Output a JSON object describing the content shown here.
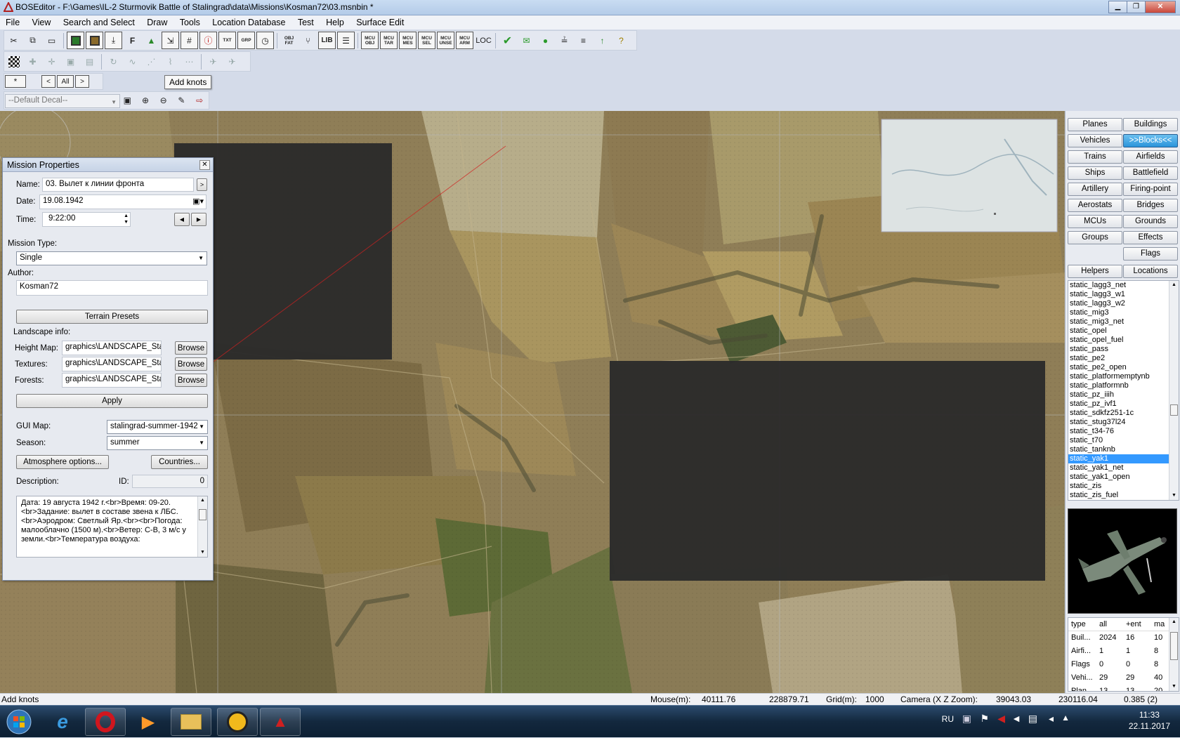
{
  "window": {
    "title": "BOSEditor - F:\\Games\\IL-2 Sturmovik Battle of Stalingrad\\data\\Missions\\Kosman72\\03.msnbin *",
    "minimize": "▁",
    "maximize": "❐",
    "close": "✕"
  },
  "menu": [
    "File",
    "View",
    "Search and Select",
    "Draw",
    "Tools",
    "Location Database",
    "Test",
    "Help",
    "Surface Edit"
  ],
  "toolbar": {
    "row1_mcu": [
      "MCU OBJ",
      "MCU TAR",
      "MCU MES",
      "MCU SEL",
      "MCU UNSE",
      "MCU ARM"
    ],
    "loc_label": "LOC",
    "lib_label": "LIB",
    "txt_label": "TXT",
    "grp_label": "GRP",
    "obj_label": "OBJ FAT",
    "nav": {
      "star": "*",
      "prev": "<",
      "all": "All",
      "next": ">"
    },
    "tooltip": "Add knots",
    "decal_select": "--Default Decal--"
  },
  "mission_properties": {
    "title": "Mission Properties",
    "name_label": "Name:",
    "name_value": "03. Вылет к линии фронта",
    "date_label": "Date:",
    "date_value": "19.08.1942",
    "time_label": "Time:",
    "time_value": "9:22:00",
    "mission_type_label": "Mission Type:",
    "mission_type_value": "Single",
    "author_label": "Author:",
    "author_value": "Kosman72",
    "terrain_presets": "Terrain Presets",
    "landscape_label": "Landscape info:",
    "height_map_label": "Height Map:",
    "height_map_value": "graphics\\LANDSCAPE_Stalin",
    "textures_label": "Textures:",
    "textures_value": "graphics\\LANDSCAPE_Stalin",
    "forests_label": "Forests:",
    "forests_value": "graphics\\LANDSCAPE_Stalin",
    "browse": "Browse",
    "apply": "Apply",
    "gui_map_label": "GUI Map:",
    "gui_map_value": "stalingrad-summer-1942",
    "season_label": "Season:",
    "season_value": "summer",
    "atmosphere_button": "Atmosphere options...",
    "countries_button": "Countries...",
    "description_label": "Description:",
    "id_label": "ID:",
    "id_value": "0",
    "description_text": "Дата: 19 августа 1942 г.<br>Время: 09-20.<br>Задание: вылет в составе звена к ЛБС.<br>Аэродром: Светлый Яр.<br><br>Погода: малооблачно (1500 м).<br>Ветер: С-В, 3 м/с у земли.<br>Температура воздуха:"
  },
  "right_panel": {
    "buttons": [
      [
        "Planes",
        "Buildings"
      ],
      [
        "Vehicles",
        ">>Blocks<<"
      ],
      [
        "Trains",
        "Airfields"
      ],
      [
        "Ships",
        "Battlefield"
      ],
      [
        "Artillery",
        "Firing-point"
      ],
      [
        "Aerostats",
        "Bridges"
      ],
      [
        "MCUs",
        "Grounds"
      ],
      [
        "Groups",
        "Effects"
      ],
      [
        "",
        "Flags"
      ],
      [
        "Helpers",
        "Locations"
      ]
    ],
    "objects": [
      "static_lagg3_net",
      "static_lagg3_w1",
      "static_lagg3_w2",
      "static_mig3",
      "static_mig3_net",
      "static_opel",
      "static_opel_fuel",
      "static_pass",
      "static_pe2",
      "static_pe2_open",
      "static_platformemptynb",
      "static_platformnb",
      "static_pz_iiih",
      "static_pz_ivf1",
      "static_sdkfz251-1c",
      "static_stug37l24",
      "static_t34-76",
      "static_t70",
      "static_tanknb",
      "static_yak1",
      "static_yak1_net",
      "static_yak1_open",
      "static_zis",
      "static_zis_fuel"
    ],
    "selected_object": "static_yak1",
    "stats_header": [
      "type",
      "all",
      "+ent",
      "ma"
    ],
    "stats_rows": [
      [
        "Buil...",
        "2024",
        "16",
        "10"
      ],
      [
        "Airfi...",
        "1",
        "1",
        "8"
      ],
      [
        "Flags",
        "0",
        "0",
        "8"
      ],
      [
        "Vehi...",
        "29",
        "29",
        "40"
      ],
      [
        "Plan...",
        "13",
        "13",
        "20"
      ]
    ]
  },
  "status": {
    "message": "Add knots",
    "mouse_label": "Mouse(m):",
    "mouse_x": "40111.76",
    "mouse_z": "228879.71",
    "grid_label": "Grid(m):",
    "grid_value": "1000",
    "camera_label": "Camera (X Z Zoom):",
    "camera_x": "39043.03",
    "camera_z": "230116.04",
    "camera_zoom": "0.385 (2)"
  },
  "taskbar": {
    "lang": "RU",
    "time": "11:33",
    "date": "22.11.2017"
  },
  "colors": {
    "accent": "#3399ff",
    "active_button": "#2a94da",
    "route_line": "#d02020"
  }
}
